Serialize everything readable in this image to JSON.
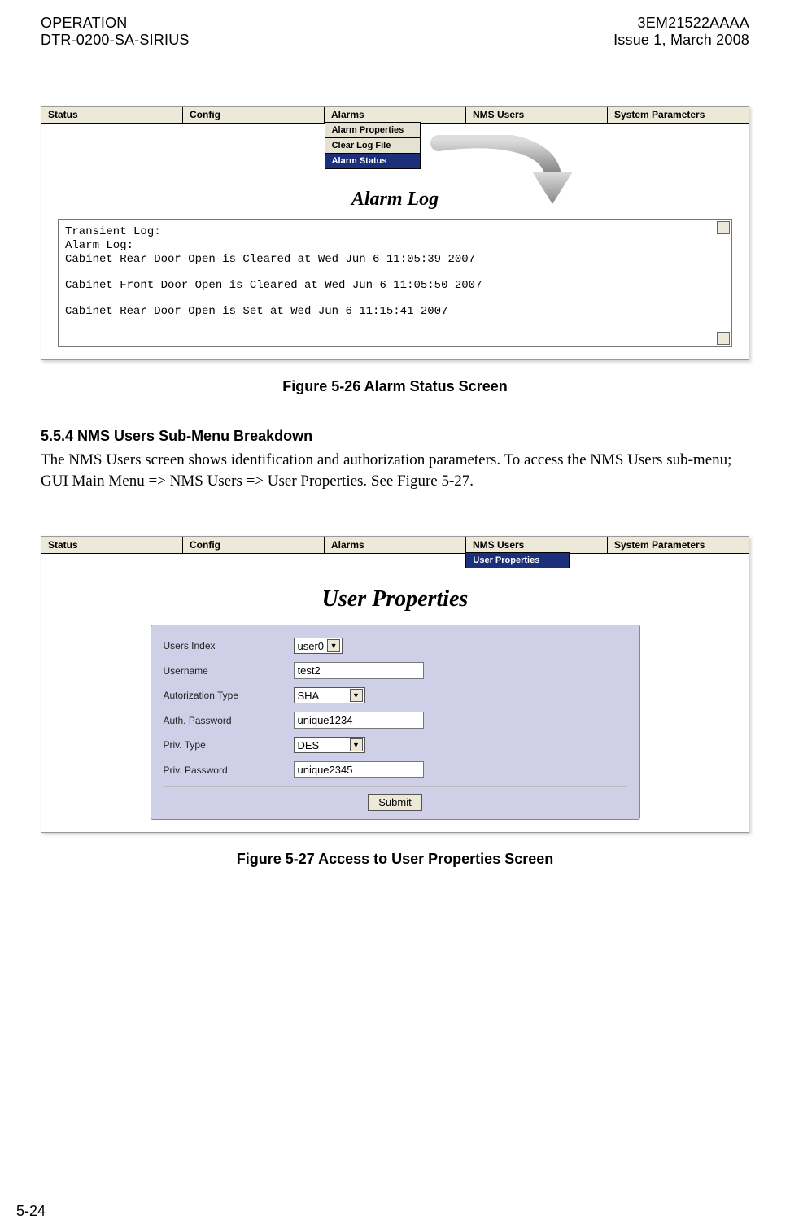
{
  "header": {
    "left1": "OPERATION",
    "left2": "DTR-0200-SA-SIRIUS",
    "right1": "3EM21522AAAA",
    "right2": "Issue 1, March 2008"
  },
  "fig26": {
    "menu": [
      "Status",
      "Config",
      "Alarms",
      "NMS Users",
      "System Parameters"
    ],
    "submenu": [
      "Alarm Properties",
      "Clear Log File",
      "Alarm Status"
    ],
    "title": "Alarm Log",
    "log": [
      "Transient Log:",
      "Alarm Log:",
      "Cabinet Rear Door Open is Cleared at Wed Jun  6 11:05:39 2007",
      "",
      "Cabinet Front Door Open is Cleared at Wed Jun  6 11:05:50 2007",
      "",
      "Cabinet Rear Door Open is Set at Wed Jun  6 11:15:41 2007"
    ],
    "caption": "Figure 5-26  Alarm Status Screen"
  },
  "section": {
    "heading": "5.5.4   NMS Users Sub-Menu Breakdown",
    "para": "The NMS Users screen shows identification and authorization parameters. To access the NMS Users sub-menu; GUI Main Menu => NMS Users => User Properties. See Figure 5-27."
  },
  "fig27": {
    "menu": [
      "Status",
      "Config",
      "Alarms",
      "NMS Users",
      "System Parameters"
    ],
    "submenu": [
      "User Properties"
    ],
    "title": "User Properties",
    "form": {
      "rows": [
        {
          "label": "Users Index",
          "type": "select",
          "value": "user0"
        },
        {
          "label": "Username",
          "type": "text",
          "value": "test2"
        },
        {
          "label": "Autorization Type",
          "type": "select",
          "value": "SHA"
        },
        {
          "label": "Auth. Password",
          "type": "text",
          "value": "unique1234"
        },
        {
          "label": "Priv. Type",
          "type": "select",
          "value": "DES"
        },
        {
          "label": "Priv. Password",
          "type": "text",
          "value": "unique2345"
        }
      ],
      "submit": "Submit"
    },
    "caption": "Figure 5-27  Access to User Properties Screen"
  },
  "page_number": "5-24"
}
